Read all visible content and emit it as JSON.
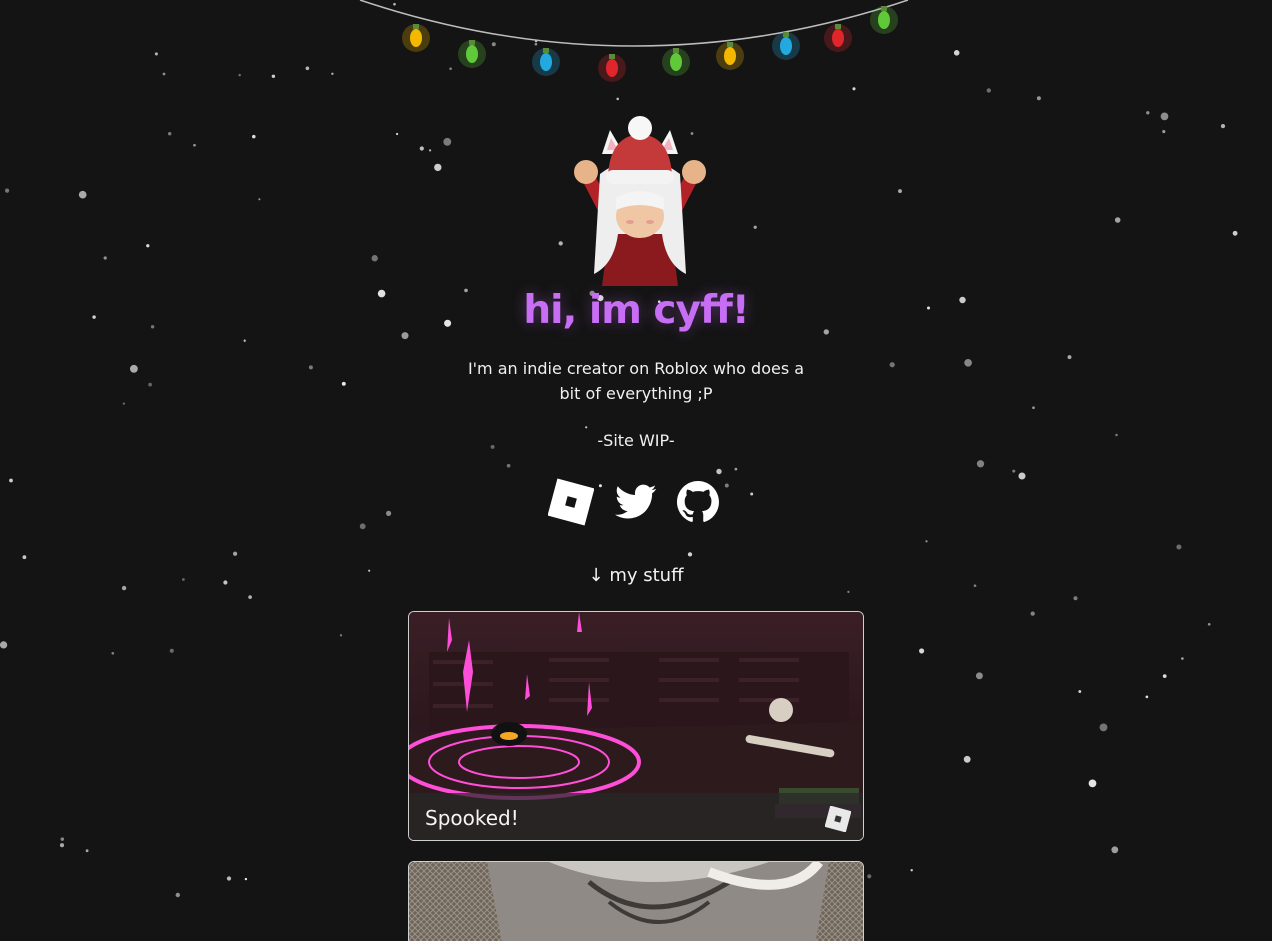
{
  "profile": {
    "heading": "hi, im cyff!",
    "bio": "I'm an indie creator on Roblox who does a bit of everything ;P",
    "status": "-Site WIP-"
  },
  "socials": [
    {
      "name": "roblox",
      "icon": "roblox-icon"
    },
    {
      "name": "twitter",
      "icon": "twitter-icon"
    },
    {
      "name": "github",
      "icon": "github-icon"
    }
  ],
  "section": {
    "label": "my stuff",
    "arrow": "↓"
  },
  "projects": [
    {
      "title": "Spooked!",
      "platform_icon": "roblox-icon"
    },
    {
      "title": ""
    }
  ],
  "colors": {
    "background": "#141414",
    "heading": "#c86ef5",
    "text": "#f0f0f0",
    "accent_glow": "#ff4fd8"
  },
  "lights": {
    "bulb_colors": [
      "#f5b800",
      "#5fc93a",
      "#22a9e0",
      "#e0262a",
      "#5fc93a",
      "#f5b800",
      "#22a9e0",
      "#e0262a",
      "#5fc93a"
    ]
  }
}
